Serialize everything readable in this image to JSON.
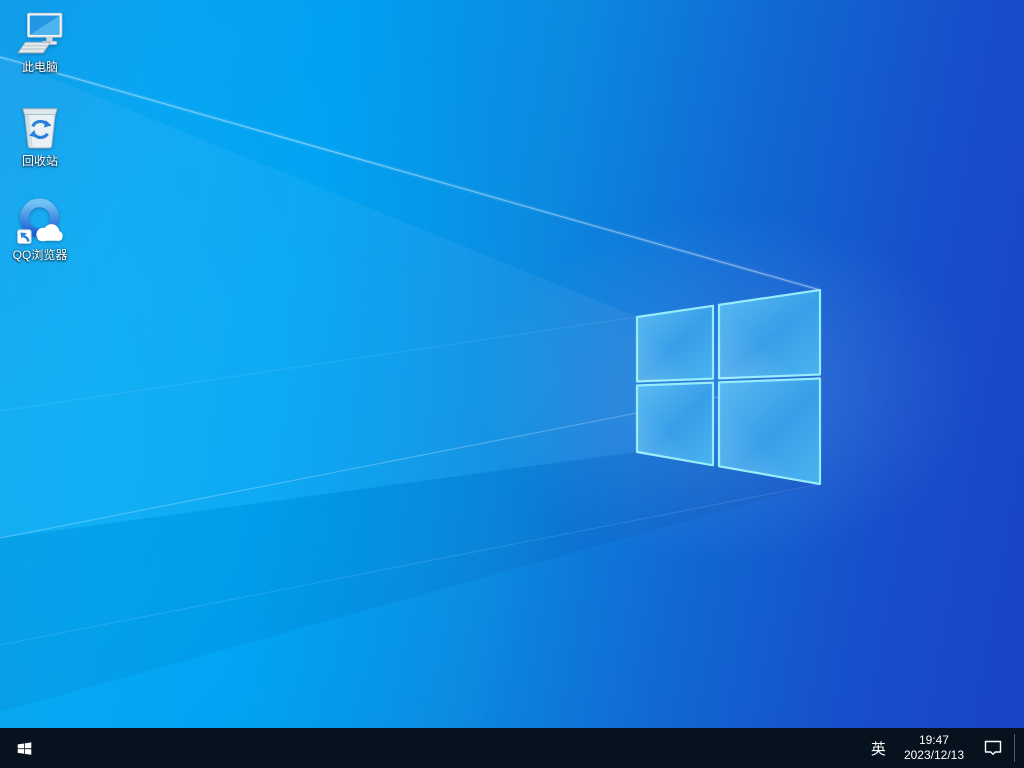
{
  "desktop": {
    "icons": [
      {
        "name": "this-pc",
        "label": "此电脑"
      },
      {
        "name": "recycle-bin",
        "label": "回收站"
      },
      {
        "name": "qq-browser",
        "label": "QQ浏览器"
      }
    ]
  },
  "taskbar": {
    "input_indicator": "英",
    "time": "19:47",
    "date": "2023/12/13"
  },
  "colors": {
    "taskbar_bg": "#06121d",
    "wallpaper_left": "#00a6f5",
    "wallpaper_right": "#1a43c5",
    "flag_edge": "#96ecfb",
    "flag_fill": "#3fa9ec"
  }
}
